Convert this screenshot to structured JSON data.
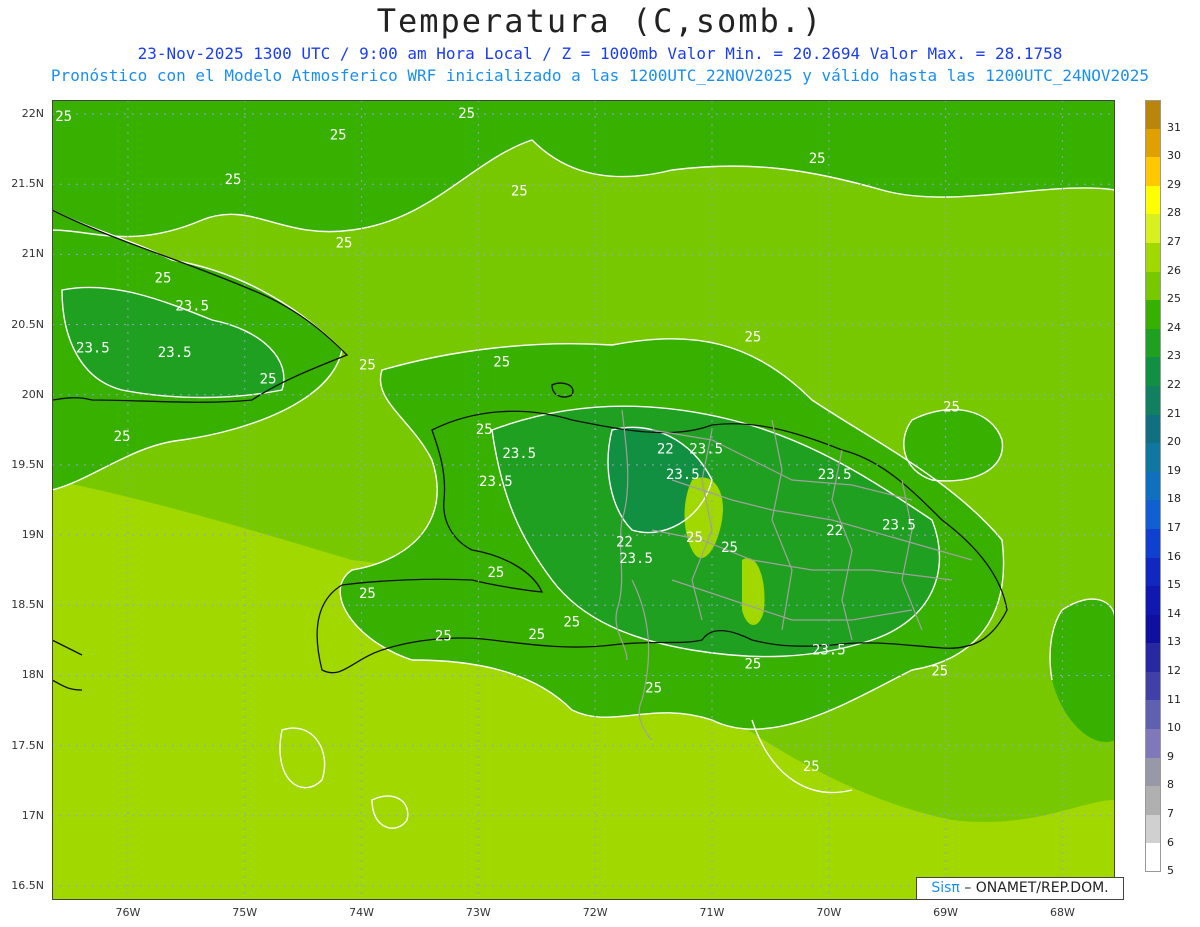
{
  "title": "Temperatura (C,somb.)",
  "subtitle1": "23-Nov-2025  1300 UTC / 9:00 am Hora Local / Z = 1000mb   Valor Min. = 20.2694  Valor Max. = 28.1758",
  "subtitle2": "Pronóstico con el Modelo Atmosferico WRF inicializado a las 1200UTC_22NOV2025 y válido hasta las  1200UTC_24NOV2025",
  "credit": {
    "brand": "Sisπ",
    "rest": " – ONAMET/REP.DOM."
  },
  "lat_labels": [
    "22N",
    "21.5N",
    "21N",
    "20.5N",
    "20N",
    "19.5N",
    "19N",
    "18.5N",
    "18N",
    "17.5N",
    "17N",
    "16.5N"
  ],
  "lon_labels": [
    "76W",
    "75W",
    "74W",
    "73W",
    "72W",
    "71W",
    "70W",
    "69W",
    "68W"
  ],
  "colorbar": {
    "labels": [
      "31",
      "30",
      "29",
      "28",
      "27",
      "26",
      "25",
      "24",
      "23",
      "22",
      "21",
      "20",
      "19",
      "18",
      "17",
      "16",
      "15",
      "14",
      "13",
      "12",
      "11",
      "10",
      "9",
      "8",
      "7",
      "6",
      "5"
    ],
    "colors": [
      "#b8860b",
      "#e0a000",
      "#ffc800",
      "#ffff00",
      "#d8f020",
      "#a0d800",
      "#78c800",
      "#38b000",
      "#20a020",
      "#109040",
      "#108060",
      "#107080",
      "#1078a0",
      "#1070c0",
      "#1060d0",
      "#1040d0",
      "#1028c0",
      "#1018b0",
      "#1010a0",
      "#2828a0",
      "#4040a8",
      "#6060b0",
      "#8078b8",
      "#9898a8",
      "#b0b0b0",
      "#d0d0d0",
      "#ffffff"
    ]
  },
  "contour_labels": [
    {
      "text": "25",
      "lon": -76.55,
      "lat": 21.95
    },
    {
      "text": "25",
      "lon": -73.1,
      "lat": 21.97
    },
    {
      "text": "25",
      "lon": -74.2,
      "lat": 21.82
    },
    {
      "text": "25",
      "lon": -75.1,
      "lat": 21.5
    },
    {
      "text": "25",
      "lon": -72.65,
      "lat": 21.42
    },
    {
      "text": "25",
      "lon": -70.1,
      "lat": 21.65
    },
    {
      "text": "25",
      "lon": -74.15,
      "lat": 21.05
    },
    {
      "text": "25",
      "lon": -75.7,
      "lat": 20.8
    },
    {
      "text": "23.5",
      "lon": -75.45,
      "lat": 20.6
    },
    {
      "text": "23.5",
      "lon": -76.3,
      "lat": 20.3
    },
    {
      "text": "23.5",
      "lon": -75.6,
      "lat": 20.27
    },
    {
      "text": "25",
      "lon": -74.8,
      "lat": 20.08
    },
    {
      "text": "25",
      "lon": -73.95,
      "lat": 20.18
    },
    {
      "text": "25",
      "lon": -72.8,
      "lat": 20.2
    },
    {
      "text": "25",
      "lon": -76.05,
      "lat": 19.67
    },
    {
      "text": "25",
      "lon": -70.65,
      "lat": 20.38
    },
    {
      "text": "25",
      "lon": -68.95,
      "lat": 19.88
    },
    {
      "text": "25",
      "lon": -72.95,
      "lat": 19.72
    },
    {
      "text": "23.5",
      "lon": -72.65,
      "lat": 19.55
    },
    {
      "text": "23.5",
      "lon": -72.85,
      "lat": 19.35
    },
    {
      "text": "22",
      "lon": -71.4,
      "lat": 19.58
    },
    {
      "text": "23.5",
      "lon": -71.05,
      "lat": 19.58
    },
    {
      "text": "23.5",
      "lon": -71.25,
      "lat": 19.4
    },
    {
      "text": "23.5",
      "lon": -69.95,
      "lat": 19.4
    },
    {
      "text": "22",
      "lon": -69.95,
      "lat": 19.0
    },
    {
      "text": "23.5",
      "lon": -69.4,
      "lat": 19.04
    },
    {
      "text": "25",
      "lon": -71.15,
      "lat": 18.95
    },
    {
      "text": "22",
      "lon": -71.75,
      "lat": 18.92
    },
    {
      "text": "25",
      "lon": -70.85,
      "lat": 18.88
    },
    {
      "text": "23.5",
      "lon": -71.65,
      "lat": 18.8
    },
    {
      "text": "25",
      "lon": -72.85,
      "lat": 18.7
    },
    {
      "text": "25",
      "lon": -73.95,
      "lat": 18.55
    },
    {
      "text": "25",
      "lon": -72.2,
      "lat": 18.35
    },
    {
      "text": "25",
      "lon": -72.5,
      "lat": 18.26
    },
    {
      "text": "25",
      "lon": -73.3,
      "lat": 18.25
    },
    {
      "text": "23.5",
      "lon": -70.0,
      "lat": 18.15
    },
    {
      "text": "25",
      "lon": -70.65,
      "lat": 18.05
    },
    {
      "text": "25",
      "lon": -69.05,
      "lat": 18.0
    },
    {
      "text": "25",
      "lon": -71.5,
      "lat": 17.88
    },
    {
      "text": "25",
      "lon": -70.15,
      "lat": 17.32
    }
  ]
}
